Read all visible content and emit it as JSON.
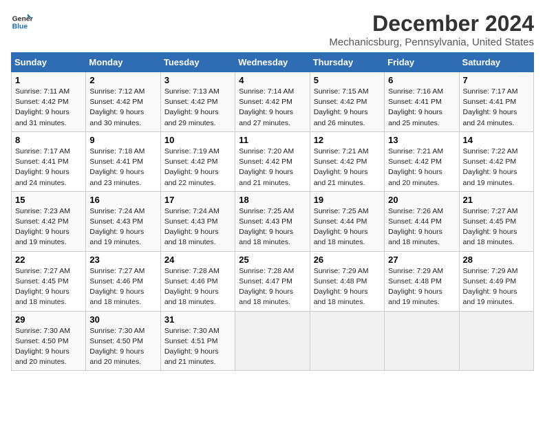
{
  "header": {
    "logo_line1": "General",
    "logo_line2": "Blue",
    "month_title": "December 2024",
    "location": "Mechanicsburg, Pennsylvania, United States"
  },
  "weekdays": [
    "Sunday",
    "Monday",
    "Tuesday",
    "Wednesday",
    "Thursday",
    "Friday",
    "Saturday"
  ],
  "weeks": [
    [
      {
        "day": "1",
        "sunrise": "Sunrise: 7:11 AM",
        "sunset": "Sunset: 4:42 PM",
        "daylight": "Daylight: 9 hours and 31 minutes."
      },
      {
        "day": "2",
        "sunrise": "Sunrise: 7:12 AM",
        "sunset": "Sunset: 4:42 PM",
        "daylight": "Daylight: 9 hours and 30 minutes."
      },
      {
        "day": "3",
        "sunrise": "Sunrise: 7:13 AM",
        "sunset": "Sunset: 4:42 PM",
        "daylight": "Daylight: 9 hours and 29 minutes."
      },
      {
        "day": "4",
        "sunrise": "Sunrise: 7:14 AM",
        "sunset": "Sunset: 4:42 PM",
        "daylight": "Daylight: 9 hours and 27 minutes."
      },
      {
        "day": "5",
        "sunrise": "Sunrise: 7:15 AM",
        "sunset": "Sunset: 4:42 PM",
        "daylight": "Daylight: 9 hours and 26 minutes."
      },
      {
        "day": "6",
        "sunrise": "Sunrise: 7:16 AM",
        "sunset": "Sunset: 4:41 PM",
        "daylight": "Daylight: 9 hours and 25 minutes."
      },
      {
        "day": "7",
        "sunrise": "Sunrise: 7:17 AM",
        "sunset": "Sunset: 4:41 PM",
        "daylight": "Daylight: 9 hours and 24 minutes."
      }
    ],
    [
      {
        "day": "8",
        "sunrise": "Sunrise: 7:17 AM",
        "sunset": "Sunset: 4:41 PM",
        "daylight": "Daylight: 9 hours and 24 minutes."
      },
      {
        "day": "9",
        "sunrise": "Sunrise: 7:18 AM",
        "sunset": "Sunset: 4:41 PM",
        "daylight": "Daylight: 9 hours and 23 minutes."
      },
      {
        "day": "10",
        "sunrise": "Sunrise: 7:19 AM",
        "sunset": "Sunset: 4:42 PM",
        "daylight": "Daylight: 9 hours and 22 minutes."
      },
      {
        "day": "11",
        "sunrise": "Sunrise: 7:20 AM",
        "sunset": "Sunset: 4:42 PM",
        "daylight": "Daylight: 9 hours and 21 minutes."
      },
      {
        "day": "12",
        "sunrise": "Sunrise: 7:21 AM",
        "sunset": "Sunset: 4:42 PM",
        "daylight": "Daylight: 9 hours and 21 minutes."
      },
      {
        "day": "13",
        "sunrise": "Sunrise: 7:21 AM",
        "sunset": "Sunset: 4:42 PM",
        "daylight": "Daylight: 9 hours and 20 minutes."
      },
      {
        "day": "14",
        "sunrise": "Sunrise: 7:22 AM",
        "sunset": "Sunset: 4:42 PM",
        "daylight": "Daylight: 9 hours and 19 minutes."
      }
    ],
    [
      {
        "day": "15",
        "sunrise": "Sunrise: 7:23 AM",
        "sunset": "Sunset: 4:42 PM",
        "daylight": "Daylight: 9 hours and 19 minutes."
      },
      {
        "day": "16",
        "sunrise": "Sunrise: 7:24 AM",
        "sunset": "Sunset: 4:43 PM",
        "daylight": "Daylight: 9 hours and 19 minutes."
      },
      {
        "day": "17",
        "sunrise": "Sunrise: 7:24 AM",
        "sunset": "Sunset: 4:43 PM",
        "daylight": "Daylight: 9 hours and 18 minutes."
      },
      {
        "day": "18",
        "sunrise": "Sunrise: 7:25 AM",
        "sunset": "Sunset: 4:43 PM",
        "daylight": "Daylight: 9 hours and 18 minutes."
      },
      {
        "day": "19",
        "sunrise": "Sunrise: 7:25 AM",
        "sunset": "Sunset: 4:44 PM",
        "daylight": "Daylight: 9 hours and 18 minutes."
      },
      {
        "day": "20",
        "sunrise": "Sunrise: 7:26 AM",
        "sunset": "Sunset: 4:44 PM",
        "daylight": "Daylight: 9 hours and 18 minutes."
      },
      {
        "day": "21",
        "sunrise": "Sunrise: 7:27 AM",
        "sunset": "Sunset: 4:45 PM",
        "daylight": "Daylight: 9 hours and 18 minutes."
      }
    ],
    [
      {
        "day": "22",
        "sunrise": "Sunrise: 7:27 AM",
        "sunset": "Sunset: 4:45 PM",
        "daylight": "Daylight: 9 hours and 18 minutes."
      },
      {
        "day": "23",
        "sunrise": "Sunrise: 7:27 AM",
        "sunset": "Sunset: 4:46 PM",
        "daylight": "Daylight: 9 hours and 18 minutes."
      },
      {
        "day": "24",
        "sunrise": "Sunrise: 7:28 AM",
        "sunset": "Sunset: 4:46 PM",
        "daylight": "Daylight: 9 hours and 18 minutes."
      },
      {
        "day": "25",
        "sunrise": "Sunrise: 7:28 AM",
        "sunset": "Sunset: 4:47 PM",
        "daylight": "Daylight: 9 hours and 18 minutes."
      },
      {
        "day": "26",
        "sunrise": "Sunrise: 7:29 AM",
        "sunset": "Sunset: 4:48 PM",
        "daylight": "Daylight: 9 hours and 18 minutes."
      },
      {
        "day": "27",
        "sunrise": "Sunrise: 7:29 AM",
        "sunset": "Sunset: 4:48 PM",
        "daylight": "Daylight: 9 hours and 19 minutes."
      },
      {
        "day": "28",
        "sunrise": "Sunrise: 7:29 AM",
        "sunset": "Sunset: 4:49 PM",
        "daylight": "Daylight: 9 hours and 19 minutes."
      }
    ],
    [
      {
        "day": "29",
        "sunrise": "Sunrise: 7:30 AM",
        "sunset": "Sunset: 4:50 PM",
        "daylight": "Daylight: 9 hours and 20 minutes."
      },
      {
        "day": "30",
        "sunrise": "Sunrise: 7:30 AM",
        "sunset": "Sunset: 4:50 PM",
        "daylight": "Daylight: 9 hours and 20 minutes."
      },
      {
        "day": "31",
        "sunrise": "Sunrise: 7:30 AM",
        "sunset": "Sunset: 4:51 PM",
        "daylight": "Daylight: 9 hours and 21 minutes."
      },
      null,
      null,
      null,
      null
    ]
  ]
}
